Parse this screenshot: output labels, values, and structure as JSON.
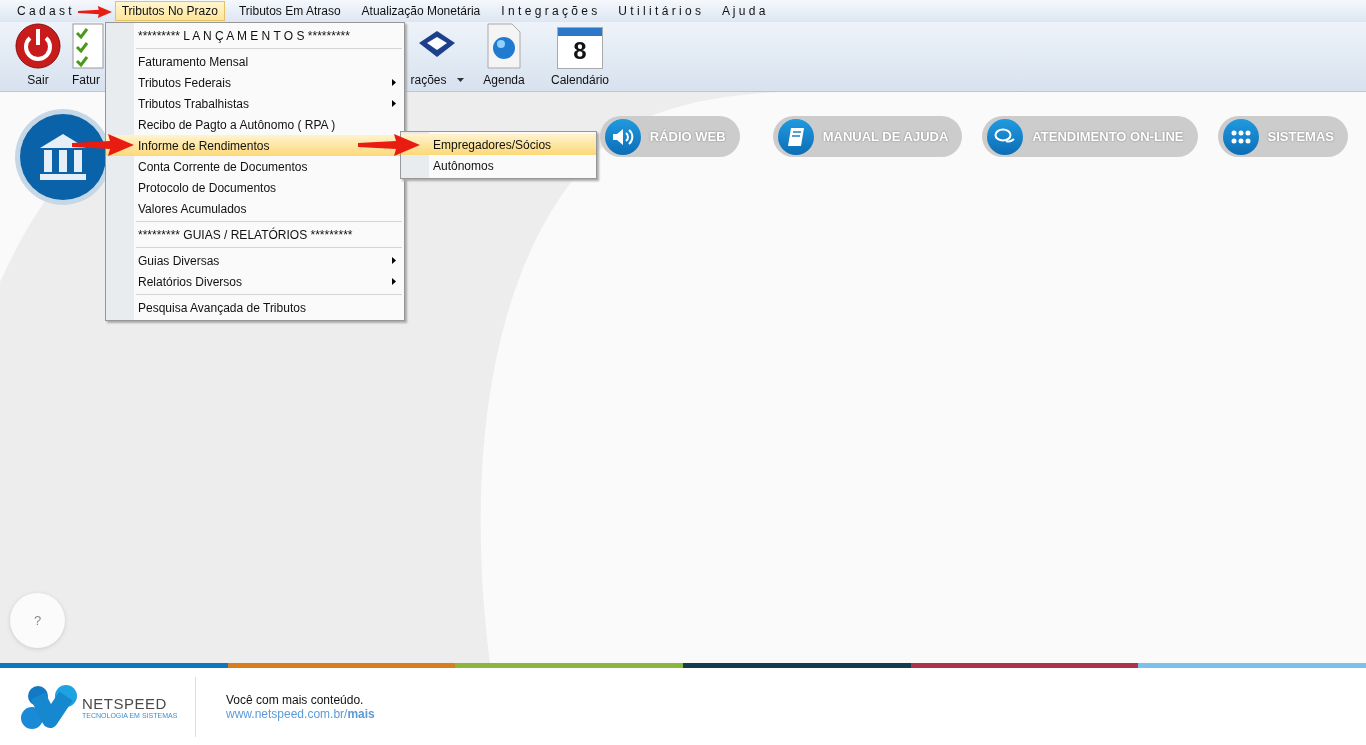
{
  "menu_bar": [
    {
      "label": "C a d a s t",
      "selected": false
    },
    {
      "label": "Tributos No Prazo",
      "selected": true
    },
    {
      "label": "Tributos Em Atraso",
      "selected": false
    },
    {
      "label": "Atualização Monetária",
      "selected": false
    },
    {
      "label": "I n t e g r a ç õ e s",
      "selected": false
    },
    {
      "label": "U t i l i t á r i o s",
      "selected": false
    },
    {
      "label": "A j u d a",
      "selected": false
    }
  ],
  "toolbar": [
    {
      "kind": "power",
      "label": "Sair",
      "has_dropdown": false
    },
    {
      "kind": "checklist",
      "label": "Fatur"
    },
    {
      "kind": "emblem",
      "label": "rações",
      "has_dropdown": true
    },
    {
      "kind": "globe",
      "label": "Agenda",
      "has_dropdown": false
    },
    {
      "kind": "calendar",
      "label": "Calendário",
      "badge": "8",
      "has_dropdown": false
    }
  ],
  "dropdown": {
    "items": [
      {
        "kind": "header",
        "label": "********* L A N Ç A M E N T O S *********"
      },
      {
        "kind": "separator"
      },
      {
        "kind": "item",
        "label": "Faturamento Mensal",
        "has_submenu": false,
        "selected": false
      },
      {
        "kind": "item",
        "label": "Tributos Federais",
        "has_submenu": true,
        "selected": false
      },
      {
        "kind": "item",
        "label": "Tributos Trabalhistas",
        "has_submenu": true,
        "selected": false
      },
      {
        "kind": "item",
        "label": "Recibo de Pagto a Autônomo ( RPA )",
        "has_submenu": false,
        "selected": false
      },
      {
        "kind": "item",
        "label": "Informe de Rendimentos",
        "has_submenu": false,
        "selected": true
      },
      {
        "kind": "item",
        "label": "Conta Corrente de Documentos",
        "has_submenu": false,
        "selected": false
      },
      {
        "kind": "item",
        "label": "Protocolo de Documentos",
        "has_submenu": false,
        "selected": false
      },
      {
        "kind": "item",
        "label": "Valores Acumulados",
        "has_submenu": false,
        "selected": false
      },
      {
        "kind": "separator"
      },
      {
        "kind": "header",
        "label": "********* GUIAS / RELATÓRIOS *********"
      },
      {
        "kind": "separator"
      },
      {
        "kind": "item",
        "label": "Guias Diversas",
        "has_submenu": true,
        "selected": false
      },
      {
        "kind": "item",
        "label": "Relatórios Diversos",
        "has_submenu": true,
        "selected": false
      },
      {
        "kind": "separator"
      },
      {
        "kind": "item",
        "label": "Pesquisa Avançada de Tributos",
        "has_submenu": false,
        "selected": false
      }
    ]
  },
  "submenu": {
    "items": [
      {
        "label": "Empregadores/Sócios",
        "selected": true
      },
      {
        "label": "Autônomos",
        "selected": false
      }
    ]
  },
  "quick_links": [
    {
      "kind": "speaker",
      "label": "RÁDIO WEB"
    },
    {
      "kind": "book",
      "label": "MANUAL DE AJUDA"
    },
    {
      "kind": "chat",
      "label": "ATENDIMENTO ON-LINE"
    },
    {
      "kind": "grid",
      "label": "SISTEMAS"
    }
  ],
  "help_button": {
    "label": "?"
  },
  "footer": {
    "logo_name": "NETSPEED",
    "logo_tagline": "TECNOLOGIA EM SISTEMAS",
    "slogan": "Você com mais conteúdo.",
    "link": "www.netspeed.com.br/**mais**"
  }
}
